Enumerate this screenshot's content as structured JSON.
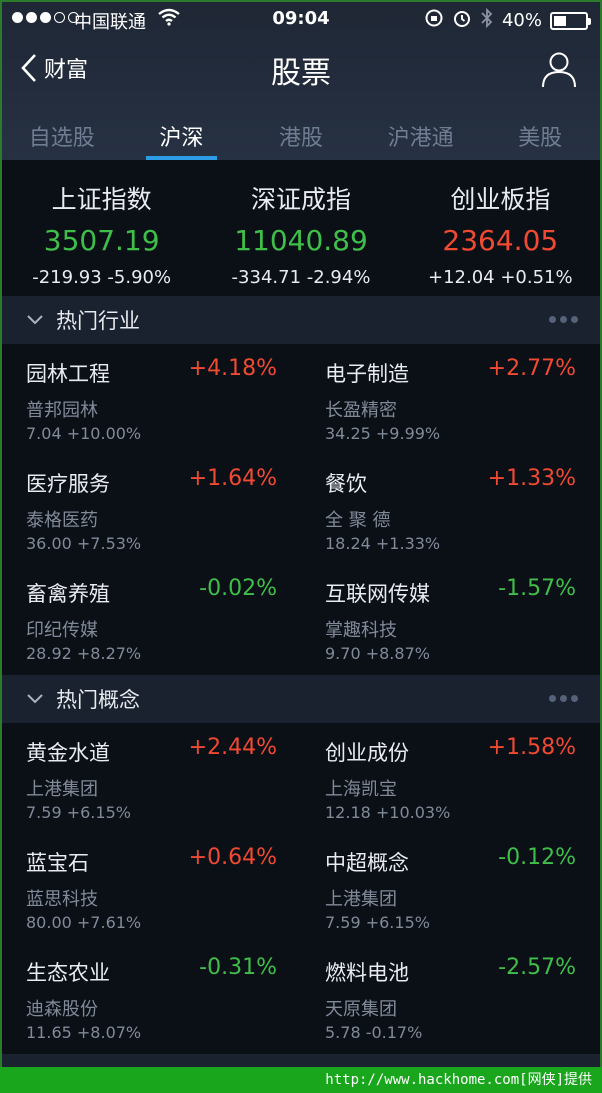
{
  "status_bar": {
    "carrier": "中国联通",
    "time": "09:04",
    "battery": "40%",
    "battery_level": 0.4
  },
  "nav": {
    "back_label": "财富",
    "title": "股票"
  },
  "tabs": [
    {
      "label": "自选股",
      "active": false
    },
    {
      "label": "沪深",
      "active": true
    },
    {
      "label": "港股",
      "active": false
    },
    {
      "label": "沪港通",
      "active": false
    },
    {
      "label": "美股",
      "active": false
    }
  ],
  "indices": [
    {
      "name": "上证指数",
      "value": "3507.19",
      "change": "-219.93 -5.90%",
      "trend": "down"
    },
    {
      "name": "深证成指",
      "value": "11040.89",
      "change": "-334.71 -2.94%",
      "trend": "down"
    },
    {
      "name": "创业板指",
      "value": "2364.05",
      "change": "+12.04 +0.51%",
      "trend": "up"
    }
  ],
  "sections": [
    {
      "title": "热门行业",
      "items": [
        {
          "name": "园林工程",
          "pct": "+4.18%",
          "trend": "up",
          "stock": "普邦园林",
          "meta": "7.04  +10.00%"
        },
        {
          "name": "电子制造",
          "pct": "+2.77%",
          "trend": "up",
          "stock": "长盈精密",
          "meta": "34.25  +9.99%"
        },
        {
          "name": "医疗服务",
          "pct": "+1.64%",
          "trend": "up",
          "stock": "泰格医药",
          "meta": "36.00  +7.53%"
        },
        {
          "name": "餐饮",
          "pct": "+1.33%",
          "trend": "up",
          "stock": "全 聚 德",
          "meta": "18.24  +1.33%"
        },
        {
          "name": "畜禽养殖",
          "pct": "-0.02%",
          "trend": "down",
          "stock": "印纪传媒",
          "meta": "28.92  +8.27%"
        },
        {
          "name": "互联网传媒",
          "pct": "-1.57%",
          "trend": "down",
          "stock": "掌趣科技",
          "meta": "9.70  +8.87%"
        }
      ]
    },
    {
      "title": "热门概念",
      "items": [
        {
          "name": "黄金水道",
          "pct": "+2.44%",
          "trend": "up",
          "stock": "上港集团",
          "meta": "7.59  +6.15%"
        },
        {
          "name": "创业成份",
          "pct": "+1.58%",
          "trend": "up",
          "stock": "上海凯宝",
          "meta": "12.18  +10.03%"
        },
        {
          "name": "蓝宝石",
          "pct": "+0.64%",
          "trend": "up",
          "stock": "蓝思科技",
          "meta": "80.00  +7.61%"
        },
        {
          "name": "中超概念",
          "pct": "-0.12%",
          "trend": "down",
          "stock": "上港集团",
          "meta": "7.59  +6.15%"
        },
        {
          "name": "生态农业",
          "pct": "-0.31%",
          "trend": "down",
          "stock": "迪森股份",
          "meta": "11.65  +8.07%"
        },
        {
          "name": "燃料电池",
          "pct": "-2.57%",
          "trend": "down",
          "stock": "天原集团",
          "meta": "5.78  -0.17%"
        }
      ]
    }
  ],
  "watermark": "http://www.hackhome.com[网侠]提供",
  "colors": {
    "up": "#f04a32",
    "down": "#3fbf4a",
    "accent": "#2e9be6"
  }
}
